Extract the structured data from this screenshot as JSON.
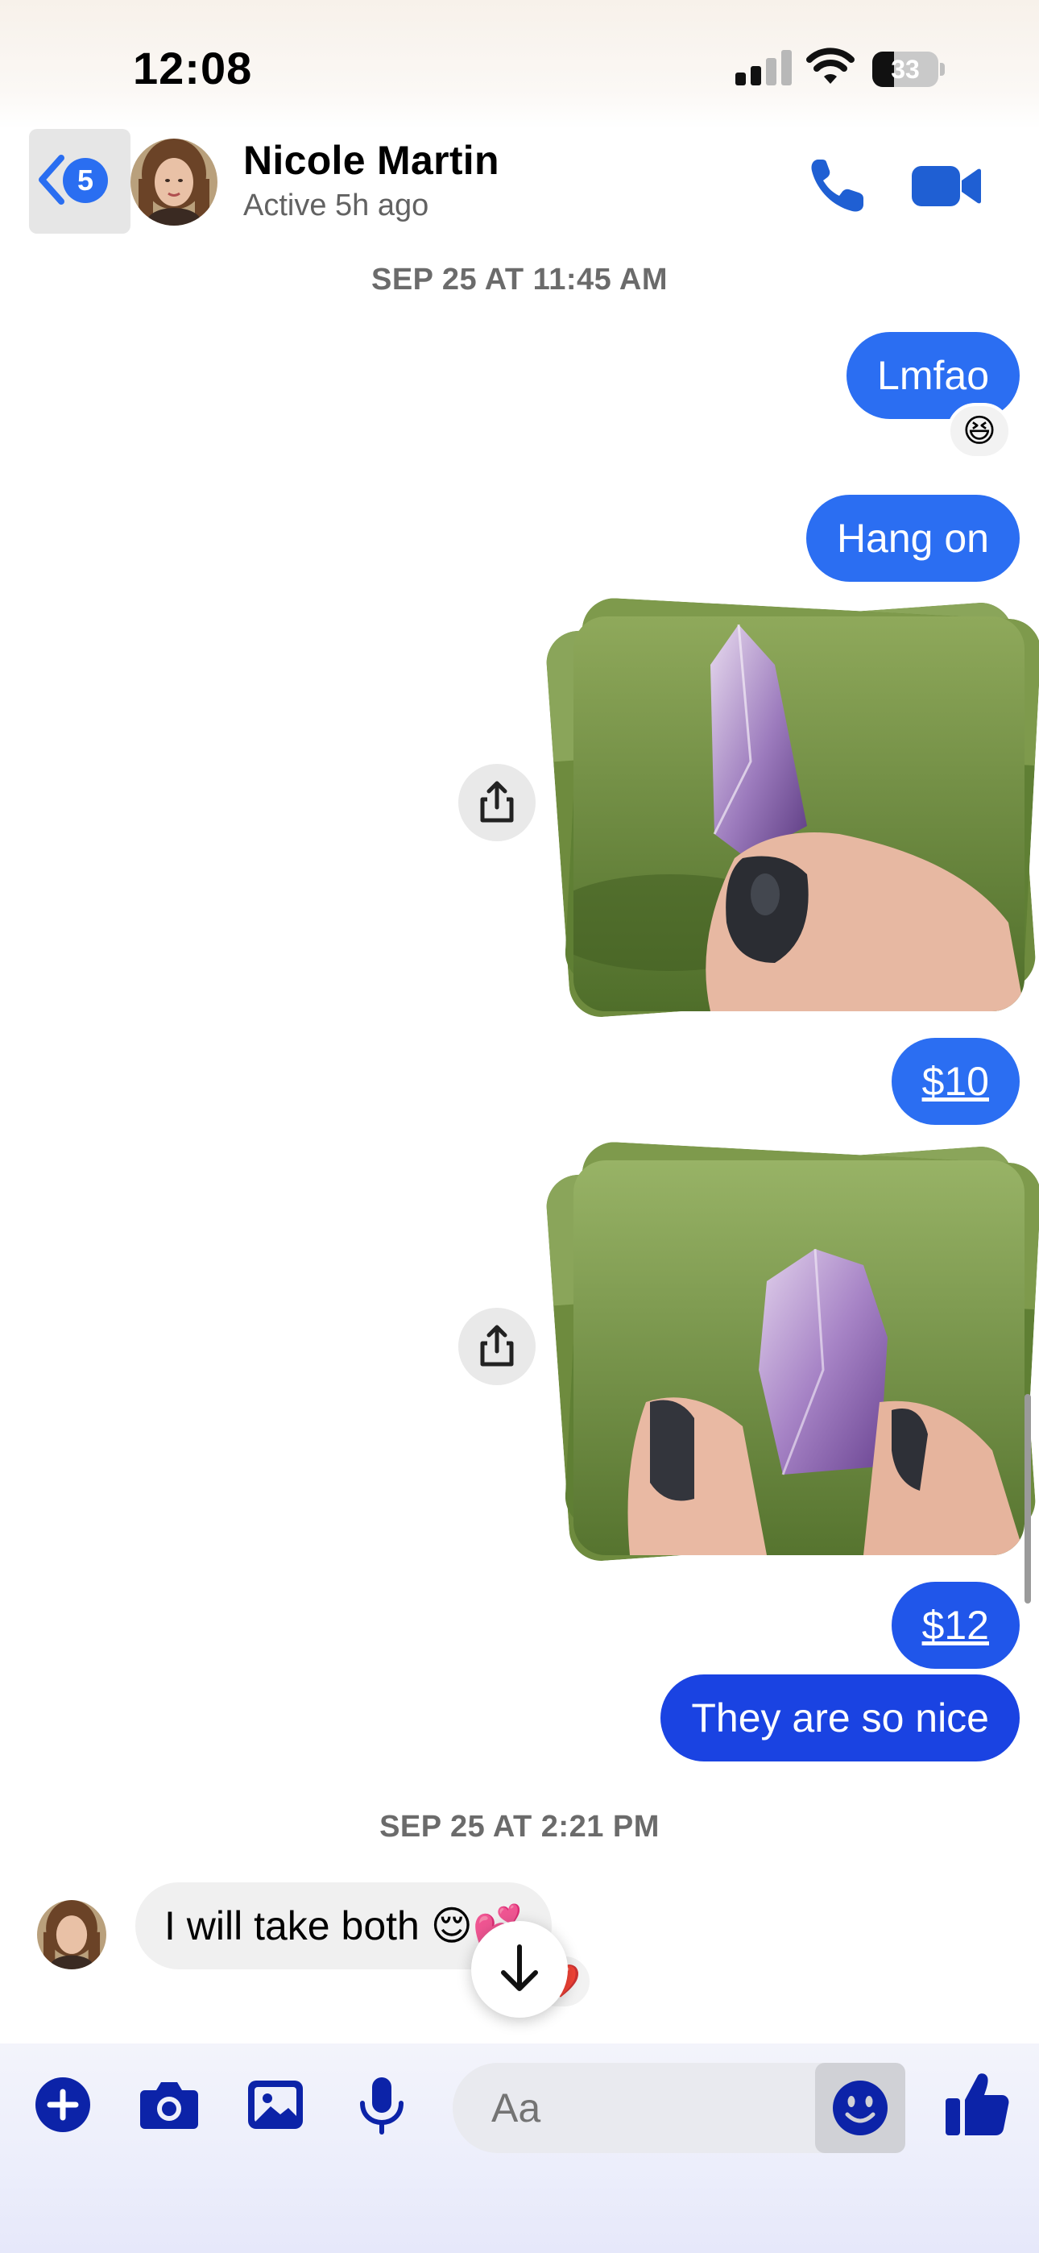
{
  "status_bar": {
    "time": "12:08",
    "battery_percent": "33",
    "signal_bars_active": 2,
    "signal_bars_total": 4
  },
  "header": {
    "back_badge": "5",
    "contact_name": "Nicole Martin",
    "contact_status": "Active 5h ago"
  },
  "conversation": {
    "timestamp_1": "SEP 25 AT 11:45 AM",
    "msg_lmfao": "Lmfao",
    "reaction_lmfao": "😆",
    "msg_hang_on": "Hang on",
    "price_1": "$10",
    "price_2": "$12",
    "msg_so_nice": "They are so nice",
    "timestamp_2": "SEP 25 AT 2:21 PM",
    "incoming_msg": "I will take both 😌💕",
    "incoming_reaction": "❤️"
  },
  "composer": {
    "placeholder": "Aa"
  },
  "colors": {
    "accent": "#2a6ef1",
    "bubble_light": "#2b6ef2",
    "bubble_dark": "#1a43e2",
    "icon_navy": "#0c23a8",
    "header_icon": "#1f5fd3"
  },
  "icons": [
    "chevron-left-icon",
    "phone-icon",
    "video-camera-icon",
    "share-icon",
    "arrow-down-icon",
    "plus-icon",
    "camera-icon",
    "gallery-icon",
    "microphone-icon",
    "smiley-icon",
    "thumbs-up-icon"
  ]
}
